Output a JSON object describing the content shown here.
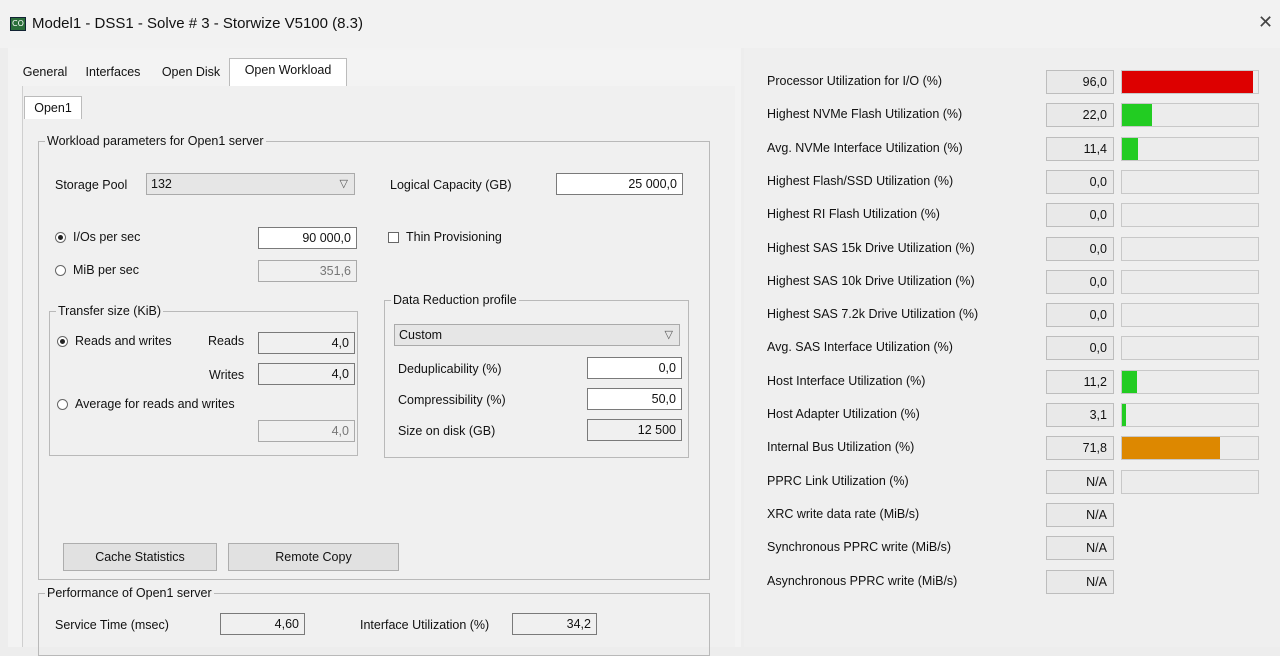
{
  "window": {
    "icon": "app-icon",
    "title": "Model1 - DSS1 - Solve # 3 - Storwize V5100 (8.3)",
    "close_label": "✕"
  },
  "tabs": [
    {
      "label": "General"
    },
    {
      "label": "Interfaces"
    },
    {
      "label": "Open Disk"
    },
    {
      "label": "Open Workload",
      "active": true
    }
  ],
  "subtab": {
    "label": "Open1"
  },
  "workload": {
    "legend": "Workload parameters for Open1 server",
    "storage_pool_label": "Storage Pool",
    "storage_pool_value": "132",
    "logical_capacity_label": "Logical Capacity (GB)",
    "logical_capacity_value": "25 000,0",
    "ios_label": "I/Os per sec",
    "ios_value": "90 000,0",
    "mib_label": "MiB per sec",
    "mib_value": "351,6",
    "thin_label": "Thin Provisioning",
    "transfer": {
      "legend": "Transfer size (KiB)",
      "rw_label": "Reads and writes",
      "reads_label": "Reads",
      "reads_value": "4,0",
      "writes_label": "Writes",
      "writes_value": "4,0",
      "avg_label": "Average for reads and writes",
      "avg_value": "4,0"
    },
    "reduction": {
      "legend": "Data Reduction profile",
      "profile_value": "Custom",
      "dedup_label": "Deduplicability (%)",
      "dedup_value": "0,0",
      "compress_label": "Compressibility (%)",
      "compress_value": "50,0",
      "size_label": "Size on disk (GB)",
      "size_value": "12 500"
    },
    "cache_button": "Cache Statistics",
    "remote_button": "Remote Copy"
  },
  "performance": {
    "legend": "Performance of Open1 server",
    "service_label": "Service Time (msec)",
    "service_value": "4,60",
    "iface_label": "Interface Utilization (%)",
    "iface_value": "34,2"
  },
  "metrics": [
    {
      "label": "Processor Utilization for I/O (%)",
      "value": "96,0",
      "bar": true,
      "level": 96.0,
      "color": "#dd0000"
    },
    {
      "label": "Highest NVMe Flash Utilization (%)",
      "value": "22,0",
      "bar": true,
      "level": 22.0,
      "color": "#22cc22"
    },
    {
      "label": "Avg. NVMe Interface Utilization (%)",
      "value": "11,4",
      "bar": true,
      "level": 11.4,
      "color": "#22cc22"
    },
    {
      "label": "Highest Flash/SSD Utilization (%)",
      "value": "0,0",
      "bar": true,
      "level": 0,
      "color": "#22cc22"
    },
    {
      "label": "Highest RI Flash Utilization (%)",
      "value": "0,0",
      "bar": true,
      "level": 0,
      "color": "#22cc22"
    },
    {
      "label": "Highest SAS 15k Drive Utilization (%)",
      "value": "0,0",
      "bar": true,
      "level": 0,
      "color": "#22cc22"
    },
    {
      "label": "Highest SAS 10k Drive Utilization (%)",
      "value": "0,0",
      "bar": true,
      "level": 0,
      "color": "#22cc22"
    },
    {
      "label": "Highest SAS 7.2k Drive Utilization (%)",
      "value": "0,0",
      "bar": true,
      "level": 0,
      "color": "#22cc22"
    },
    {
      "label": "Avg. SAS Interface Utilization (%)",
      "value": "0,0",
      "bar": true,
      "level": 0,
      "color": "#22cc22"
    },
    {
      "label": "Host Interface Utilization (%)",
      "value": "11,2",
      "bar": true,
      "level": 11.2,
      "color": "#22cc22"
    },
    {
      "label": "Host Adapter Utilization (%)",
      "value": "3,1",
      "bar": true,
      "level": 3.1,
      "color": "#22cc22"
    },
    {
      "label": "Internal Bus Utilization (%)",
      "value": "71,8",
      "bar": true,
      "level": 71.8,
      "color": "#dd8800"
    },
    {
      "label": "PPRC Link Utilization (%)",
      "value": "N/A",
      "bar": true,
      "level": 0,
      "color": "#22cc22"
    },
    {
      "label": "XRC write data rate (MiB/s)",
      "value": "N/A",
      "bar": false
    },
    {
      "label": "Synchronous PPRC write (MiB/s)",
      "value": "N/A",
      "bar": false
    },
    {
      "label": "Asynchronous PPRC write (MiB/s)",
      "value": "N/A",
      "bar": false
    }
  ]
}
